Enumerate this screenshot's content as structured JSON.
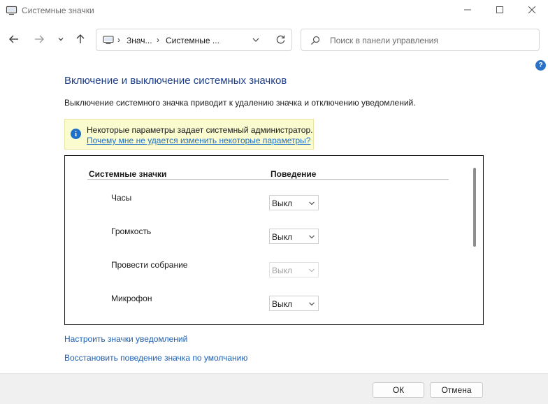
{
  "window": {
    "title": "Системные значки",
    "icon": "computer-monitor-icon",
    "controls": [
      "minimize-icon",
      "maximize-icon",
      "close-icon"
    ]
  },
  "navigation": {
    "back_icon": "arrow-left-icon",
    "forward_icon": "arrow-right-icon",
    "recent_icon": "chevron-down-icon",
    "up_icon": "arrow-up-icon",
    "breadcrumb": [
      "Знач...",
      "Системные ..."
    ],
    "refresh_icon": "refresh-icon"
  },
  "search": {
    "placeholder": "Поиск в панели управления",
    "icon": "search-icon"
  },
  "help": {
    "label": "?"
  },
  "content": {
    "title": "Включение и выключение системных значков",
    "description": "Выключение системного значка приводит к удалению значка и отключению уведомлений.",
    "info": {
      "icon_glyph": "i",
      "message": "Некоторые параметры задает системный администратор.",
      "link": "Почему мне не удается изменить некоторые параметры?"
    },
    "table": {
      "headers": {
        "name": "Системные значки",
        "behavior": "Поведение"
      },
      "rows": [
        {
          "name": "Часы",
          "behavior": "Выкл",
          "enabled": true
        },
        {
          "name": "Громкость",
          "behavior": "Выкл",
          "enabled": true
        },
        {
          "name": "Провести собрание",
          "behavior": "Выкл",
          "enabled": false
        },
        {
          "name": "Микрофон",
          "behavior": "Выкл",
          "enabled": true
        }
      ]
    },
    "links": {
      "notification_icons": "Настроить значки уведомлений",
      "restore_defaults": "Восстановить поведение значка по умолчанию"
    }
  },
  "footer": {
    "ok": "ОК",
    "cancel": "Отмена"
  },
  "colors": {
    "title_blue": "#1e3f8a",
    "link_blue": "#1c5fb5",
    "info_background": "#fbfbd0",
    "help_badge": "#2a72c8"
  }
}
